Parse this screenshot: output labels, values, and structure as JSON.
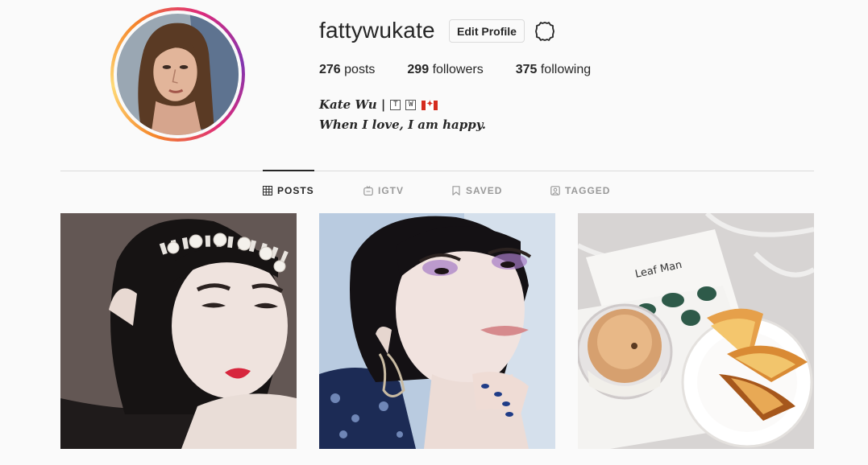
{
  "profile": {
    "username": "fattywukate",
    "edit_label": "Edit Profile",
    "posts_count": "276",
    "posts_label": "posts",
    "followers_count": "299",
    "followers_label": "followers",
    "following_count": "375",
    "following_label": "following",
    "bio_name": "Kate Wu |",
    "bio_sym_1": "T",
    "bio_sym_2": "W",
    "bio_line": "When I love, I am happy."
  },
  "tabs": [
    {
      "label": "POSTS",
      "icon": "grid-icon",
      "active": true
    },
    {
      "label": "IGTV",
      "icon": "igtv-icon",
      "active": false
    },
    {
      "label": "SAVED",
      "icon": "bookmark-icon",
      "active": false
    },
    {
      "label": "TAGGED",
      "icon": "tag-person-icon",
      "active": false
    }
  ],
  "posts": [
    {
      "caption_text": "",
      "image_text_title": ""
    },
    {
      "caption_text": ""
    },
    {
      "image_text_title": "Leaf Man"
    }
  ],
  "colors": {
    "text": "#262626",
    "muted": "#999999",
    "border": "#dbdbdb",
    "background": "#fafafa",
    "ring_orange": "#f58529",
    "ring_pink": "#dd2a7b"
  }
}
